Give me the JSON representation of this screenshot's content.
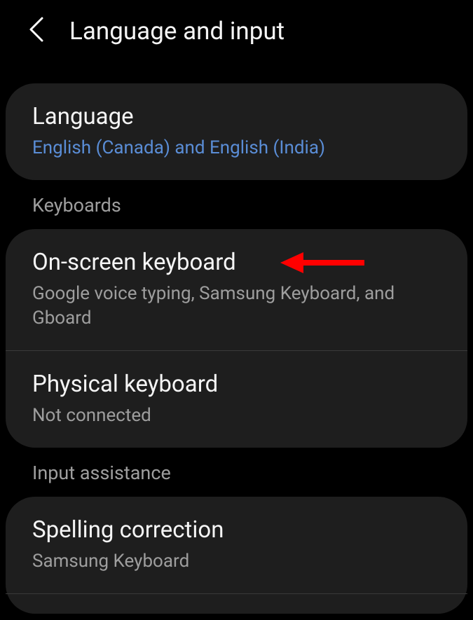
{
  "header": {
    "title": "Language and input"
  },
  "language_card": {
    "title": "Language",
    "subtitle": "English (Canada) and English (India)"
  },
  "sections": {
    "keyboards": "Keyboards",
    "input_assistance": "Input assistance"
  },
  "keyboards_card": {
    "on_screen": {
      "title": "On-screen keyboard",
      "subtitle": "Google voice typing, Samsung Keyboard, and Gboard"
    },
    "physical": {
      "title": "Physical keyboard",
      "subtitle": "Not connected"
    }
  },
  "input_assistance_card": {
    "spelling": {
      "title": "Spelling correction",
      "subtitle": "Samsung Keyboard"
    }
  }
}
